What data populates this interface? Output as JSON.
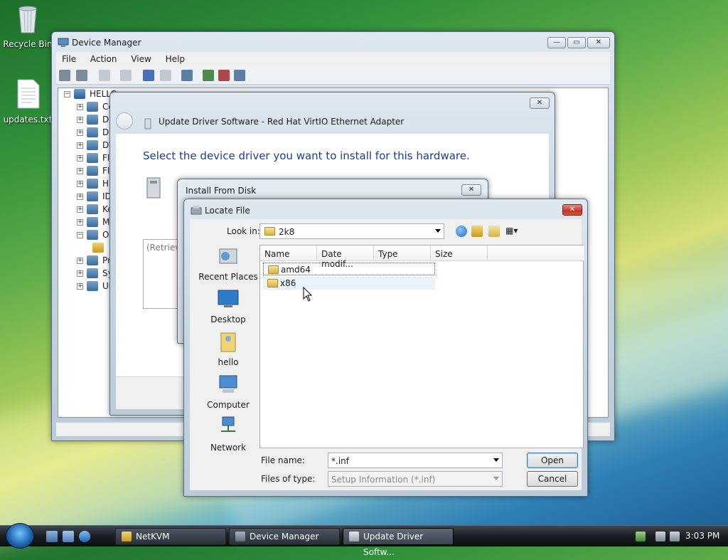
{
  "desktop": {
    "icons": [
      {
        "label": "Recycle Bin",
        "icon": "recycle-bin-icon"
      },
      {
        "label": "updates.txt",
        "icon": "text-file-icon"
      }
    ]
  },
  "device_manager": {
    "title": "Device Manager",
    "menu": [
      "File",
      "Action",
      "View",
      "Help"
    ],
    "tree_root": "HELLO",
    "tree_items": [
      "Co",
      "Di",
      "Di",
      "DV",
      "Fl",
      "Fl",
      "H",
      "ID",
      "Ke",
      "M",
      "Ot",
      "",
      "Pr",
      "Sy",
      "Ur"
    ]
  },
  "update_driver": {
    "title": "Update Driver Software - Red Hat VirtIO Ethernet Adapter",
    "heading": "Select the device driver you want to install for this hardware.",
    "list_placeholder": "(Retrievin"
  },
  "install_from_disk": {
    "title": "Install From Disk"
  },
  "locate_file": {
    "title": "Locate File",
    "look_in_label": "Look in:",
    "look_in_value": "2k8",
    "places": [
      {
        "label": "Recent Places",
        "icon": "recent-places-icon"
      },
      {
        "label": "Desktop",
        "icon": "desktop-icon"
      },
      {
        "label": "hello",
        "icon": "user-folder-icon"
      },
      {
        "label": "Computer",
        "icon": "computer-icon"
      },
      {
        "label": "Network",
        "icon": "network-icon"
      }
    ],
    "columns": [
      "Name",
      "Date modif...",
      "Type",
      "Size"
    ],
    "files": [
      {
        "name": "amd64",
        "type": "folder"
      },
      {
        "name": "x86",
        "type": "folder"
      }
    ],
    "file_name_label": "File name:",
    "file_name_value": "*.inf",
    "files_of_type_label": "Files of type:",
    "files_of_type_value": "Setup Information (*.inf)",
    "open_label": "Open",
    "cancel_label": "Cancel"
  },
  "taskbar": {
    "buttons": [
      {
        "label": "NetKVM",
        "icon": "folder-icon"
      },
      {
        "label": "Device Manager",
        "icon": "device-manager-icon"
      },
      {
        "label": "Update Driver Softw...",
        "icon": "driver-icon"
      }
    ],
    "clock": "3:03 PM"
  }
}
